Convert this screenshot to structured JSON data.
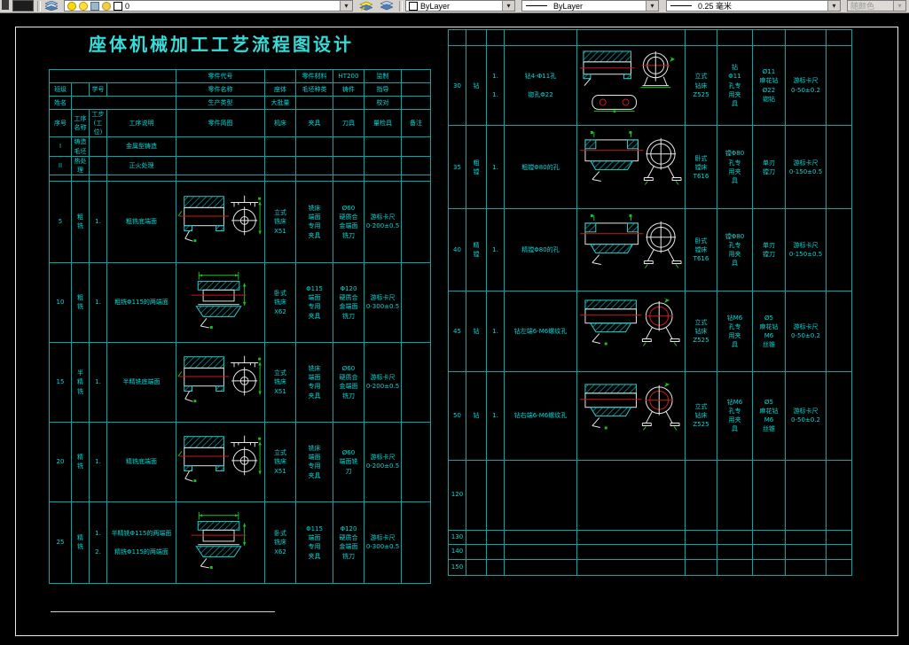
{
  "toolbar": {
    "layer_value": "0",
    "color_value": "ByLayer",
    "linetype_value": "ByLayer",
    "lineweight_value": "0.25 毫米",
    "plotstyle_value": "随颜色"
  },
  "colors": {
    "grid": "#00a8a8",
    "text": "#00d8d8",
    "title": "#35dcd8",
    "dimension": "#17c517",
    "centerline": "#cc1a1a",
    "outline": "#e8e8e8"
  },
  "title": "座体机械加工工艺流程图设计",
  "info": {
    "part_code_label": "零件代号",
    "part_material_label": "零件材料",
    "part_material_value": "HT200",
    "supervise_label": "监制",
    "class_label": "班级",
    "student_no_label": "学号",
    "part_name_label": "零件名称",
    "part_name_value": "座体",
    "blank_type_label": "毛坯种类",
    "blank_type_value": "铸件",
    "guide_label": "指导",
    "name_label": "姓名",
    "production_type_label": "生产类型",
    "production_type_value": "大批量",
    "check_label": "校对"
  },
  "columns": {
    "no": "序号",
    "name": "工序\n名称",
    "step": "工步\n(工位)",
    "desc": "工序说明",
    "sketch": "零件简图",
    "machine": "机床",
    "fixture": "夹具",
    "tool": "刀具",
    "gauge": "量检具",
    "remark": "备注"
  },
  "pre_rows": [
    {
      "no": "I",
      "name": "铸造\n毛坯",
      "desc": "金属型铸造"
    },
    {
      "no": "II",
      "name": "热处\n理",
      "desc": "正火处理"
    }
  ],
  "left_rows": [
    {
      "no": "5",
      "name": "粗\n铣",
      "steps": "1.",
      "desc": "粗铣底端面",
      "machine": "立式\n铣床\nX51",
      "fixture": "铣床\n端面\n专用\n夹具",
      "tool": "Ø60\n硬质合\n金端面\n铣刀",
      "gauge": "游标卡尺\n0-200±0.5",
      "sketch": "millSide"
    },
    {
      "no": "10",
      "name": "粗\n铣",
      "steps": "1.",
      "desc": "粗铣Φ115的两端面",
      "machine": "卧式\n铣床\nX62",
      "fixture": "Φ115\n端面\n专用\n夹具",
      "tool": "Φ120\n硬质合\n金端面\n铣刀",
      "gauge": "游标卡尺\n0-300±0.5",
      "sketch": "millFront"
    },
    {
      "no": "15",
      "name": "半\n精\n铣",
      "steps": "1.",
      "desc": "半精铣底端面",
      "machine": "立式\n铣床\nX51",
      "fixture": "铣床\n端面\n专用\n夹具",
      "tool": "Ø60\n硬质合\n金端面\n铣刀",
      "gauge": "游标卡尺\n0-200±0.5",
      "sketch": "millSide"
    },
    {
      "no": "20",
      "name": "精\n铣",
      "steps": "1.",
      "desc": "精铣底端面",
      "machine": "立式\n铣床\nX51",
      "fixture": "铣床\n端面\n专用\n夹具",
      "tool": "Ø60\n端面铣\n刀",
      "gauge": "游标卡尺\n0-200±0.5",
      "sketch": "millSide"
    },
    {
      "no": "25",
      "name": "精\n铣",
      "steps": "1.\n\n2.",
      "desc": "半精铣Φ115的两端面\n\n精铣Φ115的两端面",
      "machine": "卧式\n铣床\nX62",
      "fixture": "Φ115\n端面\n专用\n夹具",
      "tool": "Φ120\n硬质合\n金端面\n铣刀",
      "gauge": "游标卡尺\n0-300±0.5",
      "sketch": "millFront"
    }
  ],
  "right_rows": [
    {
      "no": "30",
      "name": "钻",
      "steps": "1.\n\n1.",
      "desc": "钻4-Φ11孔\n\n锪孔Φ22",
      "machine": "立式\n钻床\nZ525",
      "fixture": "钻\nΦ11\n孔专\n用夹\n具",
      "tool": "Ø11\n麻花钻\nØ22\n锪钻",
      "gauge": "游标卡尺\n0-50±0.2",
      "sketch": "drill"
    },
    {
      "no": "35",
      "name": "粗\n镗",
      "steps": "1.",
      "desc": "粗镗Φ80的孔",
      "machine": "卧式\n镗床\nT616",
      "fixture": "镗Φ80\n孔专\n用夹\n具",
      "tool": "单刃\n镗刀",
      "gauge": "游标卡尺\n0-150±0.5",
      "sketch": "bore"
    },
    {
      "no": "40",
      "name": "精\n镗",
      "steps": "1.",
      "desc": "精镗Φ80的孔",
      "machine": "卧式\n镗床\nT616",
      "fixture": "镗Φ80\n孔专\n用夹\n具",
      "tool": "单刃\n镗刀",
      "gauge": "游标卡尺\n0-150±0.5",
      "sketch": "bore"
    },
    {
      "no": "45",
      "name": "钻",
      "steps": "1.",
      "desc": "钻左端6-M6螺纹孔",
      "machine": "立式\n钻床\nZ525",
      "fixture": "钻M6\n孔专\n用夹\n具",
      "tool": "Ø5\n麻花钻\nM6\n丝锥",
      "gauge": "游标卡尺\n0-50±0.2",
      "sketch": "tap"
    },
    {
      "no": "50",
      "name": "钻",
      "steps": "1.",
      "desc": "钻右端6-M6螺纹孔",
      "machine": "立式\n钻床\nZ525",
      "fixture": "钻M6\n孔专\n用夹\n具",
      "tool": "Ø5\n麻花钻\nM6\n丝锥",
      "gauge": "游标卡尺\n0-50±0.2",
      "sketch": "tap"
    }
  ],
  "right_tail": [
    {
      "no": "120"
    },
    {
      "no": "130"
    },
    {
      "no": "140"
    },
    {
      "no": "150"
    }
  ]
}
